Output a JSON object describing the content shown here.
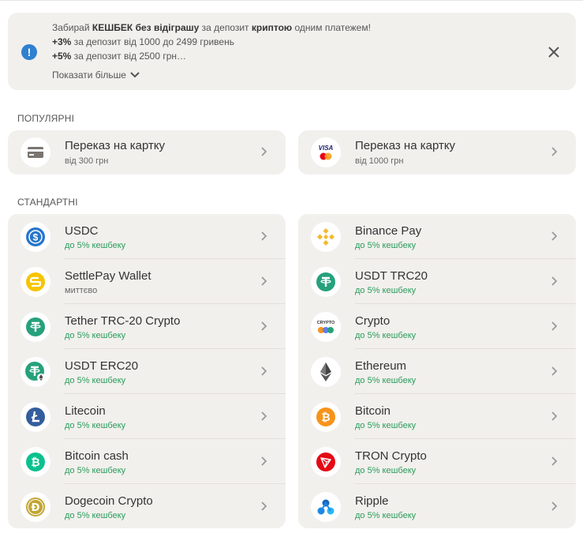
{
  "promo": {
    "line1_a": "Забирай ",
    "line1_b": "КЕШБЕК без відіграшу",
    "line1_c": " за депозит ",
    "line1_d": "криптою",
    "line1_e": " одним платежем!",
    "line2_a": "+3%",
    "line2_b": " за депозит від 1000 до 2499 гривень",
    "line3_a": "+5%",
    "line3_b": " за депозит від 2500 грн…",
    "show_more": "Показати більше"
  },
  "sections": {
    "popular": "ПОПУЛЯРНІ",
    "standard": "СТАНДАРТНІ"
  },
  "popular": [
    {
      "title": "Переказ на картку",
      "sub": "від 300 грн",
      "icon": "card-icon"
    },
    {
      "title": "Переказ на картку",
      "sub": "від 1000 грн",
      "icon": "visa-mastercard-icon"
    }
  ],
  "standard_left": [
    {
      "title": "USDC",
      "sub": "до 5% кешбеку",
      "icon": "usdc-icon"
    },
    {
      "title": "SettlePay Wallet",
      "sub": "миттєво",
      "icon": "settlepay-icon"
    },
    {
      "title": "Tether TRC-20 Crypto",
      "sub": "до 5% кешбеку",
      "icon": "tether-icon"
    },
    {
      "title": "USDT ERC20",
      "sub": "до 5% кешбеку",
      "icon": "usdt-erc20-icon"
    },
    {
      "title": "Litecoin",
      "sub": "до 5% кешбеку",
      "icon": "litecoin-icon"
    },
    {
      "title": "Bitcoin cash",
      "sub": "до 5% кешбеку",
      "icon": "bitcoin-cash-icon"
    },
    {
      "title": "Dogecoin Crypto",
      "sub": "до 5% кешбеку",
      "icon": "dogecoin-icon"
    }
  ],
  "standard_right": [
    {
      "title": "Binance Pay",
      "sub": "до 5% кешбеку",
      "icon": "binance-icon"
    },
    {
      "title": "USDT TRC20",
      "sub": "до 5% кешбеку",
      "icon": "usdt-trc20-icon"
    },
    {
      "title": "Crypto",
      "sub": "до 5% кешбеку",
      "icon": "crypto-icon"
    },
    {
      "title": "Ethereum",
      "sub": "до 5% кешбеку",
      "icon": "ethereum-icon"
    },
    {
      "title": "Bitcoin",
      "sub": "до 5% кешбеку",
      "icon": "bitcoin-icon"
    },
    {
      "title": "TRON Crypto",
      "sub": "до 5% кешбеку",
      "icon": "tron-icon"
    },
    {
      "title": "Ripple",
      "sub": "до 5% кешбеку",
      "icon": "ripple-icon"
    }
  ],
  "crypto_icon_text": "CRYPTO",
  "colors": {
    "card_bg": "#f2f0ed",
    "cashback_green": "#2a9d5c",
    "info_blue": "#2f80d0"
  }
}
